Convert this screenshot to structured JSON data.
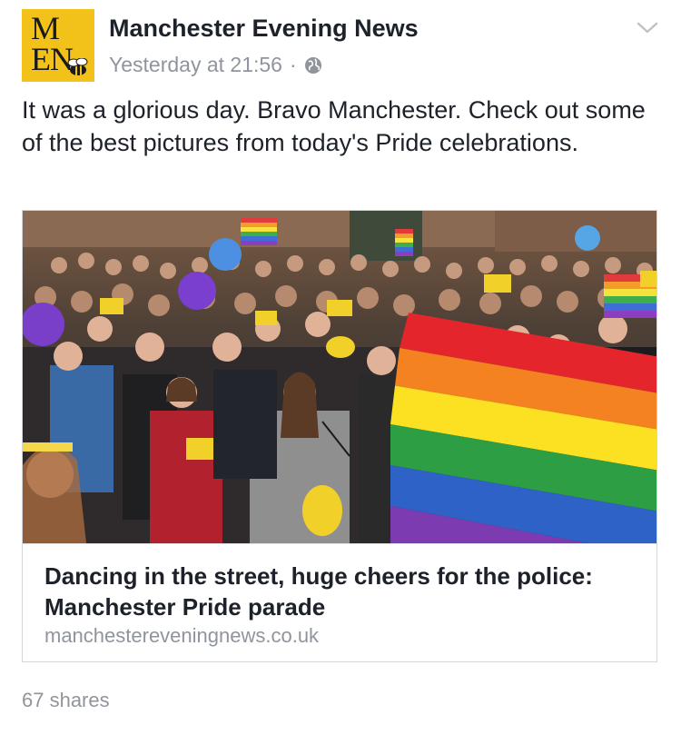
{
  "page": {
    "name": "Manchester Evening News",
    "logo_line1": "M",
    "logo_line2": "EN",
    "timestamp": "Yesterday at 21:56",
    "separator": "·",
    "privacy_icon": "globe-icon",
    "menu_icon": "chevron-down-icon"
  },
  "post": {
    "text": "It was a glorious day. Bravo Manchester. Check out some of the best pictures from today's Pride celebrations."
  },
  "link": {
    "title": "Dancing in the street, huge cheers for the police: Manchester Pride parade",
    "domain": "manchestereveningnews.co.uk"
  },
  "footer": {
    "shares": "67 shares"
  },
  "colors": {
    "logo_bg": "#f2c21b",
    "text_primary": "#1d2129",
    "text_secondary": "#90949c",
    "card_border": "#d4d6da"
  }
}
